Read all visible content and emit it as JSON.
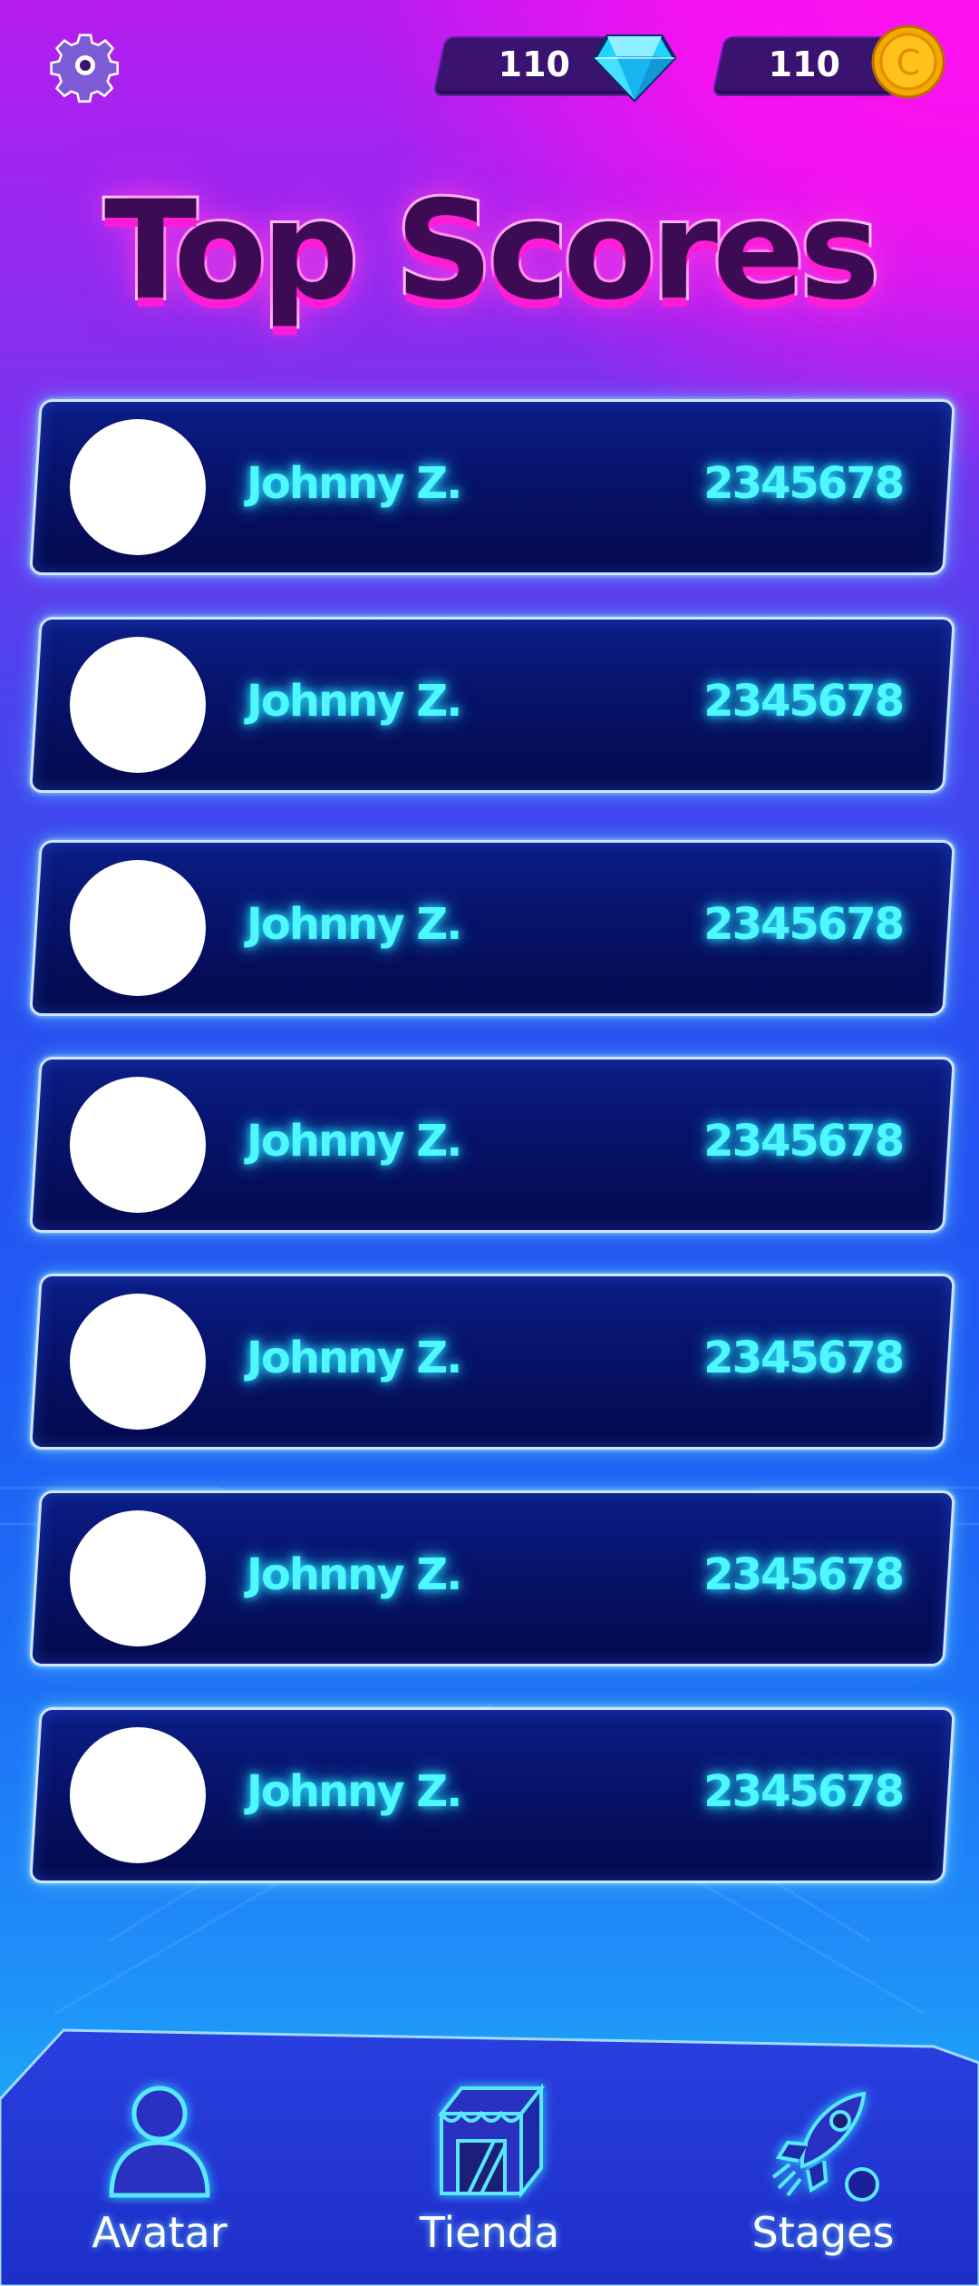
{
  "header": {
    "gems": "110",
    "coins": "110",
    "coin_symbol": "C"
  },
  "title": "Top Scores",
  "scores": [
    {
      "name": "Johnny Z.",
      "score": "2345678"
    },
    {
      "name": "Johnny Z.",
      "score": "2345678"
    },
    {
      "name": "Johnny Z.",
      "score": "2345678"
    },
    {
      "name": "Johnny Z.",
      "score": "2345678"
    },
    {
      "name": "Johnny Z.",
      "score": "2345678"
    },
    {
      "name": "Johnny Z.",
      "score": "2345678"
    },
    {
      "name": "Johnny Z.",
      "score": "2345678"
    }
  ],
  "nav": {
    "avatar": "Avatar",
    "store": "Tienda",
    "stages": "Stages"
  },
  "icons": {
    "settings": "gear-icon",
    "gems": "diamond-icon",
    "coins": "coin-icon",
    "avatar": "user-icon",
    "store": "store-icon",
    "stages": "rocket-icon"
  },
  "colors": {
    "accent_cyan": "#4ff7ff",
    "title_fill": "#3d0b53",
    "title_glow": "#ff1cd6",
    "card_bg": "#07126a"
  }
}
